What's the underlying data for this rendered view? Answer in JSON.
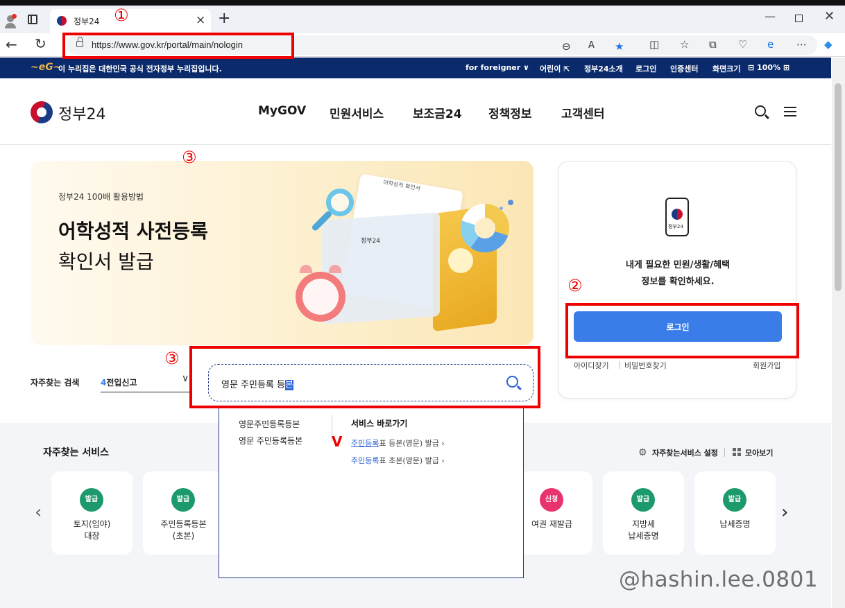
{
  "browser": {
    "tab_title": "정부24",
    "tab_close": "×",
    "new_tab": "+",
    "url": "https://www.gov.kr/portal/main/nologin",
    "win_min": "—",
    "win_close": "✕",
    "back": "←",
    "reload": "↻"
  },
  "govbar": {
    "notice": "이 누리집은 대한민국 공식 전자정부 누리집입니다.",
    "foreigner": "for foreigner ∨",
    "kids": "어린이 ⇱",
    "about": "정부24소개",
    "login": "로그인",
    "cert": "인증센터",
    "zoom_label": "화면크기",
    "zoom_value": "⊟ 100% ⊞"
  },
  "header": {
    "brand": "정부24",
    "menu": [
      "MyGOV",
      "민원서비스",
      "보조금24",
      "정책정보",
      "고객센터"
    ]
  },
  "banner": {
    "subtitle": "정부24 100배 활용방법",
    "title_line1": "어학성적 사전등록",
    "title_line2": "확인서 발급",
    "doc_title": "어학성적 확인서",
    "doc_logo": "정부24"
  },
  "login_card": {
    "phone_label": "정부24",
    "message_line1": "내게 필요한 민원/생활/혜택",
    "message_line2": "정보를 확인하세요.",
    "login_button": "로그인",
    "find_id": "아이디찾기",
    "find_pw": "비밀번호찾기",
    "signup": "회원가입"
  },
  "search": {
    "frequent_label": "자주찾는 검색",
    "frequent_num": "4",
    "frequent_value": "전입신고",
    "query_main": "영문 주민등록 등",
    "query_selected": "본"
  },
  "dropdown": {
    "suggestions": [
      "영문주민등록등본",
      "영문 주민등록등본"
    ],
    "shortcut_title": "서비스 바로가기",
    "links": [
      {
        "hl": "주민등록",
        "rest": "표 등본(영문) 발급 ›"
      },
      {
        "hl": "주민등록",
        "rest": "표 초본(영문) 발급 ›"
      }
    ],
    "v_mark": "V"
  },
  "services": {
    "title": "자주찾는 서비스",
    "settings": "자주찾는서비스 설정",
    "view_all": "모아보기",
    "arrow_left": "‹",
    "arrow_right": "›",
    "cards": [
      {
        "badge": "발급",
        "name": "토지(임야)\n대장",
        "color": "#1d9a6c"
      },
      {
        "badge": "발급",
        "name": "주민등록등본\n(초본)",
        "color": "#1d9a6c"
      },
      {
        "badge": "신청",
        "name": "여권 재발급",
        "color": "#e8336d"
      },
      {
        "badge": "발급",
        "name": "지방세\n납세증명",
        "color": "#1d9a6c"
      },
      {
        "badge": "발급",
        "name": "납세증명",
        "color": "#1d9a6c"
      }
    ]
  },
  "annotations": {
    "circle1": "①",
    "circle2": "②",
    "circle3a": "③",
    "circle3b": "③"
  },
  "watermark": "@hashin.lee.0801"
}
